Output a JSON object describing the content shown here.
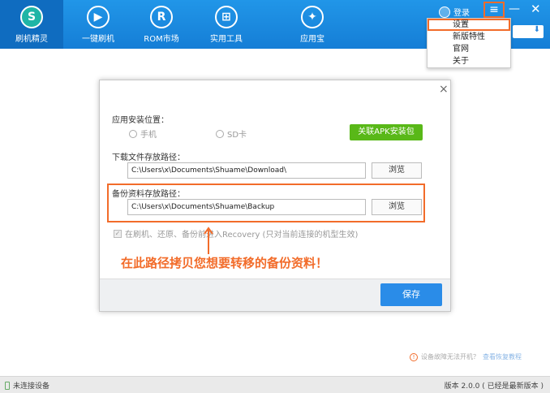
{
  "nav": {
    "items": [
      {
        "label": "刷机精灵",
        "icon": "shield-s-icon",
        "glyph": "S"
      },
      {
        "label": "一键刷机",
        "icon": "play-icon",
        "glyph": "▶"
      },
      {
        "label": "ROM市场",
        "icon": "r-icon",
        "glyph": "R"
      },
      {
        "label": "实用工具",
        "icon": "grid-icon",
        "glyph": "⊞"
      },
      {
        "label": "应用宝",
        "icon": "app-icon",
        "glyph": "✦"
      }
    ]
  },
  "header": {
    "login_label": "登录",
    "menu_glyph": "≡",
    "minimize_glyph": "—",
    "close_glyph": "✕",
    "small_button_glyph": "⬇"
  },
  "dropdown": {
    "items": [
      "设置",
      "新版特性",
      "官网",
      "关于"
    ]
  },
  "dialog": {
    "close_glyph": "×",
    "install_location_label": "应用安装位置：",
    "radio_phone": "手机",
    "radio_sd": "SD卡",
    "apk_button": "关联APK安装包",
    "download_path_label": "下载文件存放路径：",
    "download_path_value": "C:\\Users\\x\\Documents\\Shuame\\Download\\",
    "browse_label": "浏览",
    "backup_path_label": "备份资料存放路径：",
    "backup_path_value": "C:\\Users\\x\\Documents\\Shuame\\Backup",
    "recovery_check_label": "在刷机、还原、备份前进入Recovery (只对当前连接的机型生效)",
    "annotation": "在此路径拷贝您想要转移的备份资料！",
    "save_label": "保存"
  },
  "help": {
    "text": "设备故障无法开机？",
    "link": "查看恢复教程"
  },
  "status": {
    "device": "未连接设备",
    "version": "版本 2.0.0 ( 已经是最新版本 )"
  },
  "colors": {
    "accent_orange": "#f26c2a",
    "nav_blue": "#1a88e0",
    "save_blue": "#2a8ce8",
    "apk_green": "#59b818"
  }
}
